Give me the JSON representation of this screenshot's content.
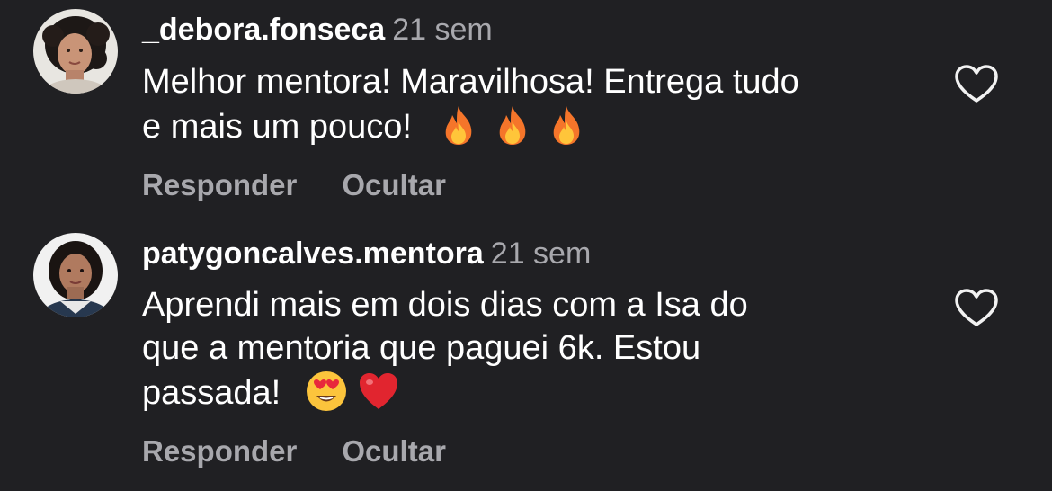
{
  "comments": [
    {
      "username": "_debora.fonseca",
      "time": "21 sem",
      "text_lines": [
        "Melhor mentora! Maravilhosa! Entrega tudo",
        "e mais um pouco!"
      ],
      "emojis": [
        "fire-emoji",
        "fire-emoji",
        "fire-emoji"
      ],
      "reply_label": "Responder",
      "hide_label": "Ocultar"
    },
    {
      "username": "patygoncalves.mentora",
      "time": "21 sem",
      "text_lines": [
        "Aprendi mais em dois dias com a Isa do",
        "que a mentoria que paguei 6k. Estou",
        "passada!"
      ],
      "emojis": [
        "heart-eyes-emoji",
        "red-heart-emoji"
      ],
      "reply_label": "Responder",
      "hide_label": "Ocultar"
    }
  ],
  "icons": {
    "like": "heart-outline-icon"
  },
  "colors": {
    "background": "#202023",
    "text": "#ffffff",
    "muted": "#a8a8ad"
  }
}
